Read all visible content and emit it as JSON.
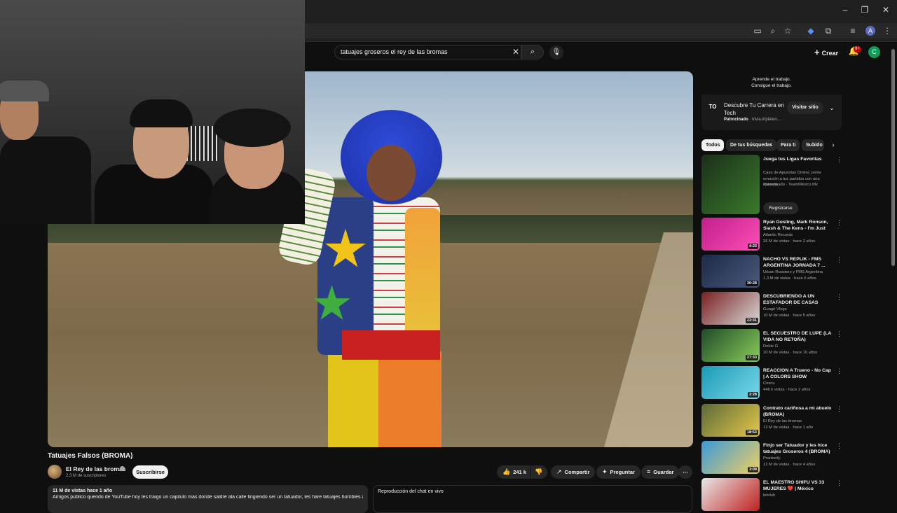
{
  "search": {
    "query": "tatuajes groseros el rey de las bromas"
  },
  "header": {
    "create_label": "Crear",
    "notif_count": "9+",
    "avatar_letter": "C",
    "profile_letter": "A"
  },
  "video": {
    "title": "Tatuajes Falsos (BROMA)",
    "channel": "El Rey de las bromas",
    "subscribers": "2,3 M de suscriptores",
    "subscribe_label": "Suscribirse",
    "likes": "241 k",
    "share_label": "Compartir",
    "ask_label": "Preguntar",
    "save_label": "Guardar"
  },
  "description": {
    "meta": "11 M de vistas  hace 1 año",
    "text": "Amigos publico querido de YouTube hoy les traigo un capitulo mas donde saldré ala calle fingiendo ser un tatuador, les hare tatuajes horribles a"
  },
  "chat": {
    "label": "Reproducción del chat en vivo"
  },
  "ad": {
    "top_line1": "Aprende el trabajo.",
    "top_line2": "Consigue el trabajo.",
    "logo": "TO",
    "title": "Descubre Tu Carrera en Tech",
    "sponsored": "Patrocinado",
    "domain": "· trivia.tripleten...",
    "visit_label": "Visitar sitio"
  },
  "chips": [
    "Todos",
    "De tus búsquedas",
    "Para ti",
    "Subido"
  ],
  "recs": [
    {
      "title": "Juega tus Ligas Favoritas",
      "channel": "Casa de Apuestas Online, ponle emoción a tus partidos con una apuesta.",
      "meta": "Patrocinado · TeamMéxico Mx",
      "duration": "",
      "button": "Registrarse",
      "thumb": [
        "#1b2f1b",
        "#3a7a2a"
      ]
    },
    {
      "title": "Ryan Gosling, Mark Ronson, Slash & The Kens - I'm Just Ke...",
      "channel": "Atlantic Records",
      "meta": "26 M de vistas · hace 2 años",
      "duration": "4:23",
      "thumb": [
        "#c0208a",
        "#ff4db8"
      ]
    },
    {
      "title": "NACHO VS REPLIK - FMS ARGENTINA JORNADA 7 ...",
      "channel": "Urban Roosters y FMS Argentina",
      "meta": "1,3 M de vistas · hace 6 años",
      "duration": "30:28",
      "thumb": [
        "#1d2a4a",
        "#4a5a7a"
      ]
    },
    {
      "title": "DESCUBRIENDO A UN ESTAFADOR DE CASAS",
      "channel": "Guagri Vlogs",
      "meta": "10 M de vistas · hace 5 años",
      "duration": "22:31",
      "thumb": [
        "#7a1f1f",
        "#d9d9d9"
      ]
    },
    {
      "title": "EL SECUESTRO DE LUPE (LA VIDA NO RETOÑA)",
      "channel": "Doble G",
      "meta": "10 M de vistas · hace 10 años",
      "duration": "27:33",
      "thumb": [
        "#1f4a2a",
        "#8acc5a"
      ]
    },
    {
      "title": "REACCION A Trueno - No Cap | A COLORS SHOW",
      "channel": "Coscu",
      "meta": "446 k vistas · hace 2 años",
      "duration": "3:28",
      "thumb": [
        "#1a9ab5",
        "#7ad8ea"
      ]
    },
    {
      "title": "Contrato cariñosa a mi abuelo (BROMA)",
      "channel": "El Rey de las bromas",
      "meta": "13 M de vistas · hace 1 año",
      "duration": "18:53",
      "thumb": [
        "#5a6a3a",
        "#e6c84a"
      ]
    },
    {
      "title": "Finjo ser Tatuador y les hice tatuajes Groseros 4 (BROMA)",
      "channel": "Prankedy",
      "meta": "12 M de vistas · hace 4 años",
      "duration": "3:09",
      "thumb": [
        "#3a9ad8",
        "#f0d060"
      ]
    },
    {
      "title": "EL MAESTRO SHIFU VS 33 MUJERES ❤️ | México",
      "channel": "lebrish",
      "meta": "",
      "duration": "",
      "thumb": [
        "#e8e8e8",
        "#c02020"
      ]
    }
  ]
}
